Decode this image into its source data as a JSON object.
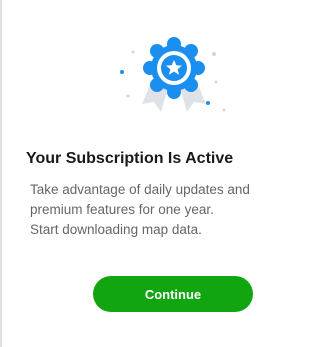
{
  "icons": {
    "badge": "award-badge-icon",
    "star": "star-icon"
  },
  "colors": {
    "accent_blue": "#1a8ff0",
    "button_green": "#11a50f"
  },
  "dialog": {
    "title": "Your Subscription Is Active",
    "description_lines": [
      "Take advantage of daily updates and",
      "premium features for one year.",
      "Start downloading map data."
    ],
    "continue_label": "Continue"
  }
}
